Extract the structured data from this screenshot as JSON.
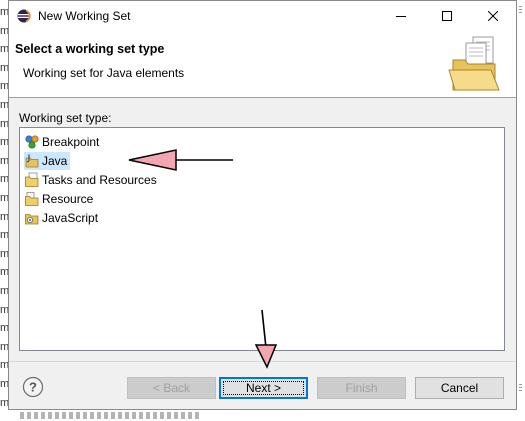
{
  "window": {
    "title": "New Working Set"
  },
  "banner": {
    "title": "Select a working set type",
    "description": "Working set for Java elements"
  },
  "list": {
    "label": "Working set type:",
    "items": [
      {
        "label": "Breakpoint",
        "icon": "breakpoint-icon",
        "selected": false
      },
      {
        "label": "Java",
        "icon": "java-project-icon",
        "selected": true
      },
      {
        "label": "Tasks and Resources",
        "icon": "tasks-folder-icon",
        "selected": false
      },
      {
        "label": "Resource",
        "icon": "resource-folder-icon",
        "selected": false
      },
      {
        "label": "JavaScript",
        "icon": "javascript-folder-icon",
        "selected": false
      }
    ]
  },
  "buttons": {
    "back": "< Back",
    "next": "Next >",
    "finish": "Finish",
    "cancel": "Cancel",
    "back_enabled": false,
    "finish_enabled": false
  },
  "background": {
    "left_letters": [
      "m",
      "m",
      "m",
      "m",
      "m",
      "m",
      "m",
      "m",
      "m",
      "m",
      "m",
      "m",
      "m",
      "m",
      "m",
      "m",
      "m",
      "m",
      "m",
      "m",
      "m",
      "m"
    ]
  },
  "colors": {
    "selection": "#cce8ff",
    "annotation_arrow_fill": "#f4a6b0",
    "default_button_border": "#0078d7"
  }
}
